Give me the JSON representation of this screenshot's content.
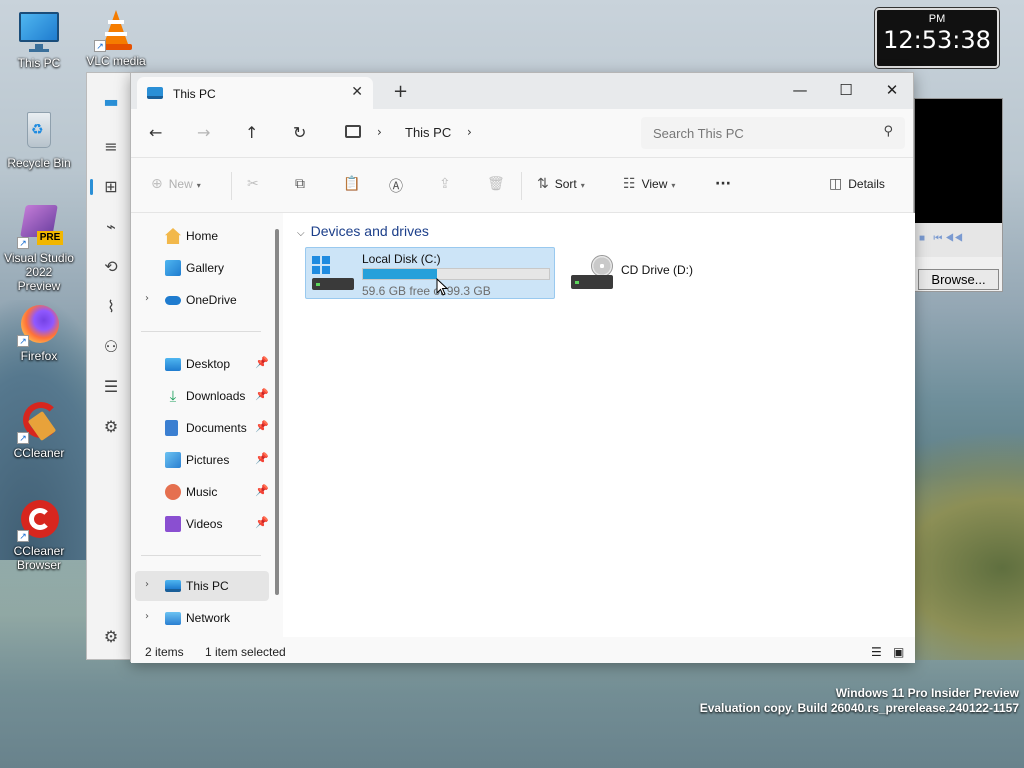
{
  "desktop": {
    "icons": [
      {
        "label": "This PC"
      },
      {
        "label": "VLC media"
      },
      {
        "label": "Recycle Bin"
      },
      {
        "label": "Visual Studio 2022 Preview"
      },
      {
        "label": "Firefox"
      },
      {
        "label": "CCleaner"
      },
      {
        "label": "CCleaner Browser"
      }
    ],
    "vs_badge": "PRE",
    "watermark_line1": "Windows 11 Pro Insider Preview",
    "watermark_line2": "Evaluation copy. Build 26040.rs_prerelease.240122-1157"
  },
  "clock": {
    "ampm": "PM",
    "time": "12:53:38"
  },
  "vlc": {
    "browse_label": "Browse..."
  },
  "window": {
    "tab_title": "This PC",
    "tab_close": "✕",
    "new_tab": "+",
    "controls": {
      "minimize": "—",
      "maximize": "☐",
      "close": "✕"
    },
    "nav": {
      "back": "←",
      "forward": "→",
      "up": "↑",
      "refresh": "↻"
    },
    "address": {
      "crumb": "This PC"
    },
    "search": {
      "placeholder": "Search This PC"
    },
    "toolbar": {
      "new_label": "New",
      "sort_label": "Sort",
      "view_label": "View",
      "more": "···",
      "details_label": "Details"
    },
    "navpane": {
      "items": [
        {
          "label": "Home"
        },
        {
          "label": "Gallery"
        },
        {
          "label": "OneDrive"
        },
        {
          "label": "Desktop"
        },
        {
          "label": "Downloads"
        },
        {
          "label": "Documents"
        },
        {
          "label": "Pictures"
        },
        {
          "label": "Music"
        },
        {
          "label": "Videos"
        },
        {
          "label": "This PC"
        },
        {
          "label": "Network"
        }
      ]
    },
    "content": {
      "group_title": "Devices and drives",
      "drives": [
        {
          "name": "Local Disk (C:)",
          "free_text": "59.6 GB free of 99.3 GB",
          "used_fraction": 0.4
        },
        {
          "name": "CD Drive (D:)"
        }
      ]
    },
    "status": {
      "item_count": "2 items",
      "selection": "1 item selected"
    }
  },
  "colors": {
    "accent": "#26a0da",
    "selection": "#cce4f7"
  }
}
